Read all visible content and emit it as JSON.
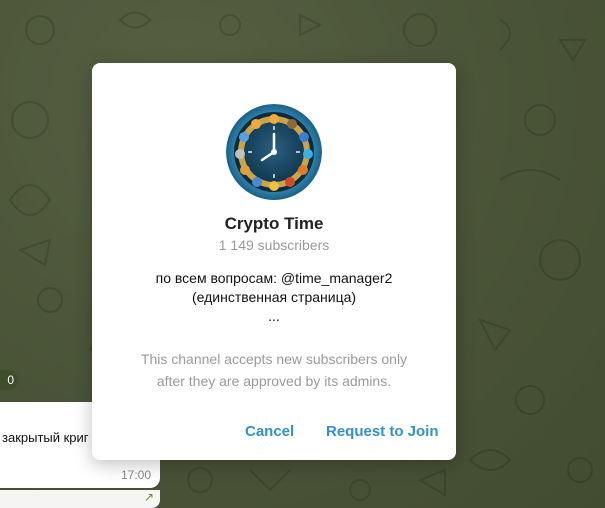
{
  "background_chat": {
    "date_badge": "0",
    "message_text": "закрытый криг",
    "message_time": "17:00",
    "forward_icon": "forward-arrow-icon"
  },
  "dialog": {
    "avatar_icon": "crypto-clock-avatar",
    "title": "Crypto Time",
    "subscribers": "1 149 subscribers",
    "description": {
      "line1": "по всем вопросам: @time_manager2",
      "line2": "(единственная страница)",
      "line3": "..."
    },
    "notice": {
      "line1": "This channel accepts new subscribers only",
      "line2": "after they are approved by its admins."
    },
    "buttons": {
      "cancel": "Cancel",
      "request": "Request to Join"
    }
  },
  "colors": {
    "accent": "#3390d0",
    "wallpaper": "#7b8a5c",
    "dialog_bg": "#ffffff",
    "muted_text": "#999999"
  }
}
